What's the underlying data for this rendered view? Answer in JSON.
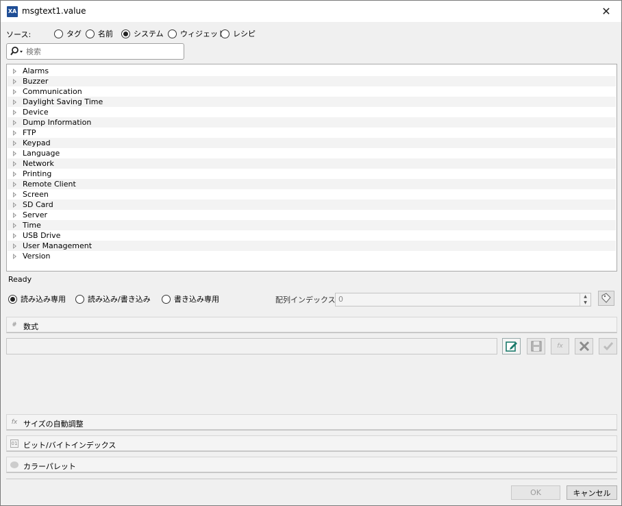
{
  "window": {
    "title": "msgtext1.value",
    "app_icon_text": "XA",
    "close_glyph": "✕"
  },
  "source": {
    "label": "ソース:",
    "options": [
      "タグ",
      "名前",
      "システム",
      "ウィジェット",
      "レシピ"
    ],
    "selected": "システム"
  },
  "search": {
    "placeholder": "検索",
    "value": ""
  },
  "tree": {
    "items": [
      "Alarms",
      "Buzzer",
      "Communication",
      "Daylight Saving Time",
      "Device",
      "Dump Information",
      "FTP",
      "Keypad",
      "Language",
      "Network",
      "Printing",
      "Remote Client",
      "Screen",
      "SD Card",
      "Server",
      "Time",
      "USB Drive",
      "User Management",
      "Version"
    ]
  },
  "status": "Ready",
  "access": {
    "options": [
      "読み込み専用",
      "読み込み/書き込み",
      "書き込み専用"
    ],
    "selected": "読み込み専用",
    "index_label": "配列インデックス:",
    "index_value": "0"
  },
  "sections": {
    "formula": "数式",
    "autosize": "サイズの自動調整",
    "bit_byte": "ビット/バイトインデックス",
    "palette": "カラーパレット"
  },
  "formula": {
    "value": ""
  },
  "icons": {
    "search": "search-icon",
    "edit": "edit-icon",
    "save": "save-icon",
    "fx": "function-icon",
    "delete": "delete-icon",
    "apply": "checkmark-icon",
    "tag": "tag-icon"
  },
  "colors": {
    "edit_accent": "#1a7a6a",
    "disabled": "#9a9a9a"
  },
  "buttons": {
    "ok": "OK",
    "cancel": "キャンセル"
  }
}
